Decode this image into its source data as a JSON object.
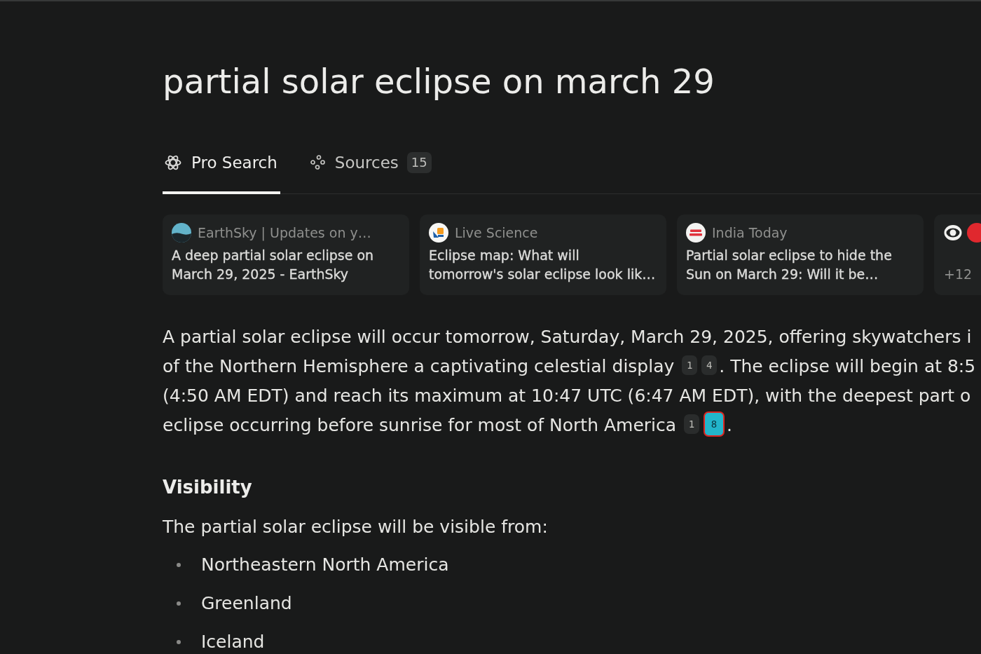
{
  "title": "partial solar eclipse on march 29",
  "tabs": [
    {
      "label": "Pro Search",
      "selected": true
    },
    {
      "label": "Sources",
      "count": "15",
      "selected": false
    }
  ],
  "sources": [
    {
      "kind": "article",
      "site": "EarthSky | Updates on y…",
      "title_lines": [
        "A deep partial solar eclipse on",
        "March 29, 2025 - EarthSky"
      ]
    },
    {
      "kind": "article",
      "site": "Live Science",
      "title_lines": [
        "Eclipse map: What will",
        "tomorrow's solar eclipse look lik…"
      ]
    },
    {
      "kind": "article",
      "site": "India Today",
      "title_lines": [
        "Partial solar eclipse to hide the",
        "Sun on March 29: Will it be…"
      ]
    },
    {
      "kind": "more",
      "label": "+12"
    }
  ],
  "answer": {
    "lines": [
      {
        "segments": [
          {
            "kind": "text",
            "text": "A partial solar eclipse will occur tomorrow, Saturday, March 29, 2025, offering skywatchers i"
          }
        ]
      },
      {
        "segments": [
          {
            "kind": "text",
            "text": "of the Northern Hemisphere a captivating celestial display "
          },
          {
            "kind": "citation",
            "label": "1",
            "selected": false
          },
          {
            "kind": "citation",
            "label": "4",
            "selected": false
          },
          {
            "kind": "text",
            "text": ". The eclipse will begin at 8:5"
          }
        ]
      },
      {
        "segments": [
          {
            "kind": "text",
            "text": "(4:50 AM EDT) and reach its maximum at 10:47 UTC (6:47 AM EDT), with the deepest part o"
          }
        ]
      },
      {
        "segments": [
          {
            "kind": "text",
            "text": "eclipse occurring before sunrise for most of North America "
          },
          {
            "kind": "citation",
            "label": "1",
            "selected": false
          },
          {
            "kind": "citation",
            "label": "8",
            "selected": true
          },
          {
            "kind": "text",
            "text": "."
          }
        ]
      }
    ]
  },
  "section": {
    "heading": "Visibility",
    "intro": "The partial solar eclipse will be visible from:",
    "items": [
      "Northeastern North America",
      "Greenland",
      "Iceland"
    ]
  }
}
